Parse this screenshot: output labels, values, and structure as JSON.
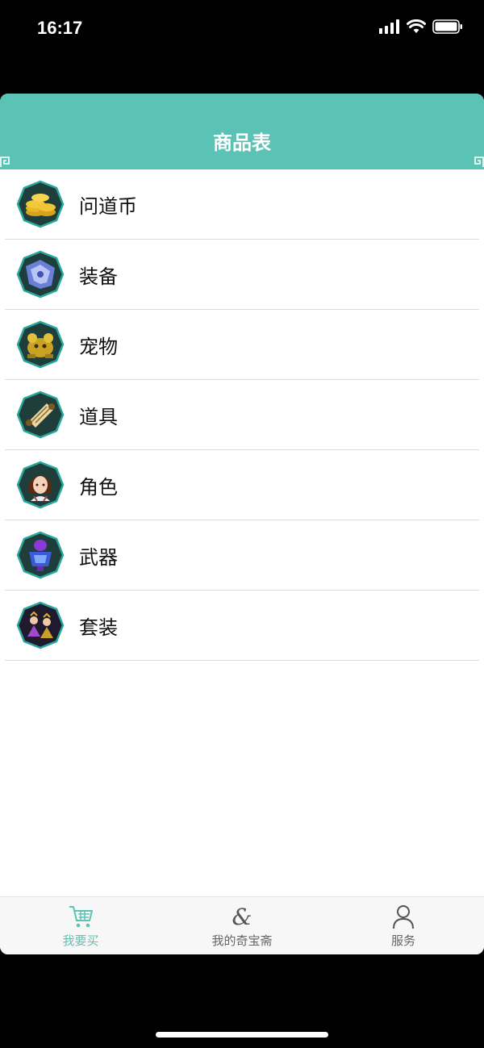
{
  "status_bar": {
    "time": "16:17"
  },
  "header": {
    "title": "商品表"
  },
  "categories": [
    {
      "label": "问道币",
      "icon": "gold-coins-icon"
    },
    {
      "label": "装备",
      "icon": "armor-icon"
    },
    {
      "label": "宠物",
      "icon": "pet-icon"
    },
    {
      "label": "道具",
      "icon": "scroll-icon"
    },
    {
      "label": "角色",
      "icon": "character-icon"
    },
    {
      "label": "武器",
      "icon": "weapon-icon"
    },
    {
      "label": "套装",
      "icon": "costume-set-icon"
    }
  ],
  "tabs": [
    {
      "label": "我要买",
      "icon": "cart-icon",
      "active": true
    },
    {
      "label": "我的奇宝斋",
      "icon": "ampersand-icon",
      "active": false
    },
    {
      "label": "服务",
      "icon": "person-icon",
      "active": false
    }
  ],
  "colors": {
    "accent": "#5bc3b5",
    "icon_border": "#2aa79b",
    "icon_fill": "#1f3d3a"
  }
}
